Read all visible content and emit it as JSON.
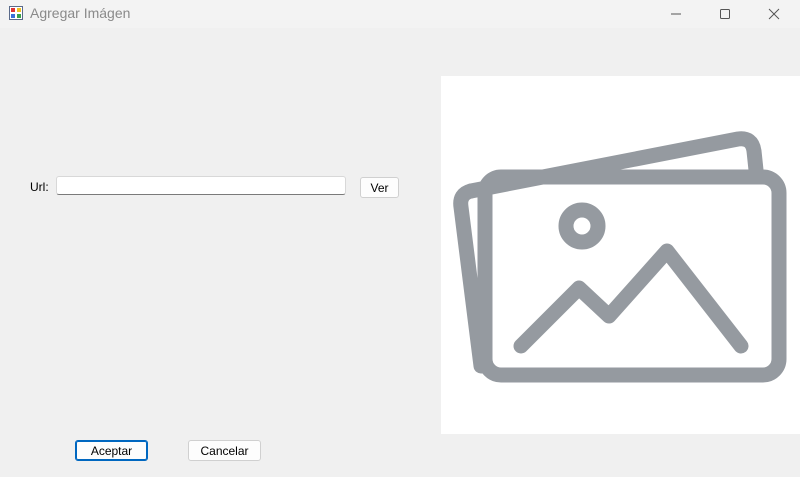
{
  "window": {
    "title": "Agregar Imágen",
    "icon": "winforms-app-icon",
    "controls": [
      "minimize-icon",
      "maximize-icon",
      "close-icon"
    ]
  },
  "form": {
    "url_label": "Url:",
    "url_value": "",
    "ver_label": "Ver",
    "aceptar_label": "Aceptar",
    "cancelar_label": "Cancelar"
  },
  "preview": {
    "icon": "image-placeholder-icon",
    "icon_color": "#959aa0"
  }
}
